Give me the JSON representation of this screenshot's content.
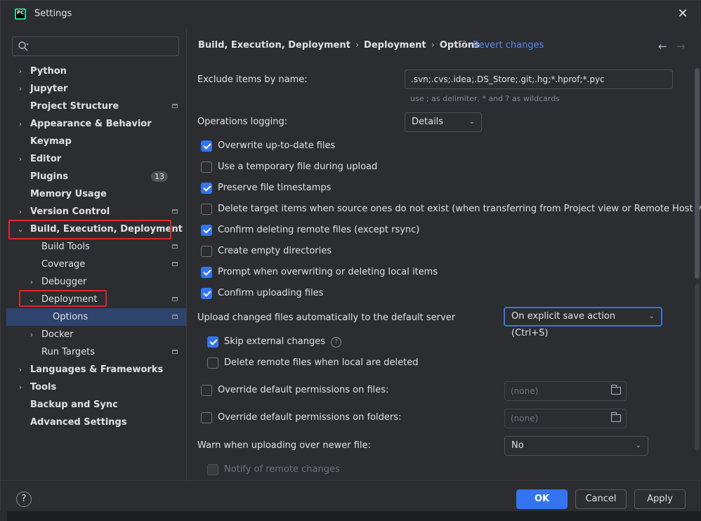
{
  "window": {
    "title": "Settings",
    "app_icon_text": "PC"
  },
  "sidebar": {
    "search_placeholder": "",
    "items": [
      {
        "label": "Python"
      },
      {
        "label": "Jupyter"
      },
      {
        "label": "Project Structure"
      },
      {
        "label": "Appearance & Behavior"
      },
      {
        "label": "Keymap"
      },
      {
        "label": "Editor"
      },
      {
        "label": "Plugins",
        "badge": "13"
      },
      {
        "label": "Memory Usage"
      },
      {
        "label": "Version Control"
      },
      {
        "label": "Build, Execution, Deployment"
      },
      {
        "label": "Build Tools"
      },
      {
        "label": "Coverage"
      },
      {
        "label": "Debugger"
      },
      {
        "label": "Deployment"
      },
      {
        "label": "Options"
      },
      {
        "label": "Docker"
      },
      {
        "label": "Run Targets"
      },
      {
        "label": "Languages & Frameworks"
      },
      {
        "label": "Tools"
      },
      {
        "label": "Backup and Sync"
      },
      {
        "label": "Advanced Settings"
      }
    ]
  },
  "breadcrumb": {
    "crumbs": [
      "Build, Execution, Deployment",
      "Deployment",
      "Options"
    ],
    "separator": "›",
    "revert_label": "Revert changes",
    "back_arrow": "←",
    "forward_arrow": "→"
  },
  "form": {
    "exclude_label": "Exclude items by name:",
    "exclude_value": ".svn;.cvs;.idea;.DS_Store;.git;.hg;*.hprof;*.pyc",
    "exclude_hint": "use ; as delimiter, * and ? as wildcards",
    "logging_label": "Operations logging:",
    "logging_value": "Details",
    "checkboxes": [
      {
        "label": "Overwrite up-to-date files",
        "checked": true
      },
      {
        "label": "Use a temporary file during upload",
        "checked": false
      },
      {
        "label": "Preserve file timestamps",
        "checked": true
      },
      {
        "label": "Delete target items when source ones do not exist (when transferring from Project view or Remote Host view)",
        "checked": false
      },
      {
        "label": "Confirm deleting remote files (except rsync)",
        "checked": true
      },
      {
        "label": "Create empty directories",
        "checked": false
      },
      {
        "label": "Prompt when overwriting or deleting local items",
        "checked": true
      },
      {
        "label": "Confirm uploading files",
        "checked": true
      }
    ],
    "upload_label": "Upload changed files automatically to the default server",
    "upload_value": "On explicit save action (Ctrl+S)",
    "skip_external_label": "Skip external changes",
    "skip_external_checked": true,
    "help_glyph": "?",
    "delete_remote_label": "Delete remote files when local are deleted",
    "delete_remote_checked": false,
    "override_files_label": "Override default permissions on files:",
    "override_files_value": "(none)",
    "override_folders_label": "Override default permissions on folders:",
    "override_folders_value": "(none)",
    "warn_label": "Warn when uploading over newer file:",
    "warn_value": "No",
    "notify_label": "Notify of remote changes"
  },
  "footer": {
    "help_label": "?",
    "ok_label": "OK",
    "cancel_label": "Cancel",
    "apply_label": "Apply"
  },
  "colors": {
    "accent": "#3574f0",
    "highlight_box": "#e0262a",
    "link": "#548af7",
    "selection": "#2e436e"
  }
}
